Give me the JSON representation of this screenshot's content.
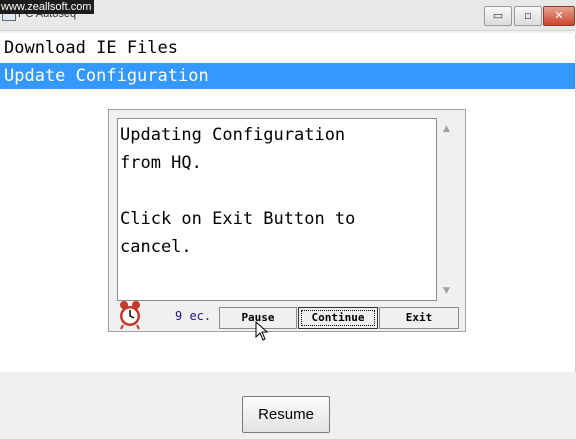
{
  "window": {
    "title": "PC Autoseq",
    "watermark": "www.zeallsoft.com",
    "controls": {
      "minimize": "▭",
      "maximize": "▫",
      "close": "✕"
    }
  },
  "list": {
    "items": [
      {
        "label": "Download IE Files",
        "selected": false
      },
      {
        "label": "Update Configuration",
        "selected": true
      }
    ]
  },
  "dialog": {
    "message_lines": [
      "Updating Configuration",
      "from HQ.",
      "",
      "Click on Exit Button to",
      "cancel."
    ],
    "countdown": "9 ec.",
    "buttons": {
      "pause": "Pause",
      "continue": "Continue",
      "exit": "Exit"
    },
    "icons": {
      "timer": "alarm-clock-icon"
    }
  },
  "footer": {
    "resume_label": "Resume"
  },
  "colors": {
    "selection": "#3399ff",
    "countdown_text": "#1a1a8c",
    "close_button": "#c9452f"
  }
}
